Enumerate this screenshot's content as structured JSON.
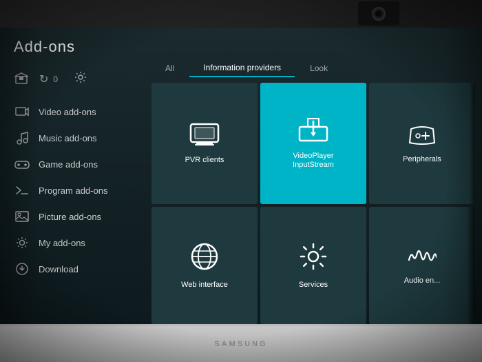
{
  "page": {
    "title": "Add-ons",
    "brand": "SAMSUNG"
  },
  "sidebar": {
    "icons": {
      "addon_icon": "🎓",
      "refresh_icon": "↻",
      "badge_count": "0",
      "settings_icon": "⚙"
    },
    "items": [
      {
        "id": "video",
        "label": "Video add-ons",
        "icon": "video"
      },
      {
        "id": "music",
        "label": "Music add-ons",
        "icon": "music"
      },
      {
        "id": "game",
        "label": "Game add-ons",
        "icon": "game"
      },
      {
        "id": "program",
        "label": "Program add-ons",
        "icon": "program"
      },
      {
        "id": "picture",
        "label": "Picture add-ons",
        "icon": "picture"
      },
      {
        "id": "my",
        "label": "My add-ons",
        "icon": "my"
      },
      {
        "id": "download",
        "label": "Download",
        "icon": "download"
      }
    ]
  },
  "tabs": [
    {
      "id": "all",
      "label": "All",
      "active": false
    },
    {
      "id": "info",
      "label": "Information providers",
      "active": true
    },
    {
      "id": "look",
      "label": "Look",
      "active": false
    }
  ],
  "tiles": [
    {
      "id": "pvr",
      "label": "PVR clients",
      "icon": "tv",
      "active": false
    },
    {
      "id": "videoplayer",
      "label": "VideoPlayer\nInputStream",
      "icon": "download_tile",
      "active": true
    },
    {
      "id": "peripherals",
      "label": "Peripherals",
      "icon": "peripherals",
      "active": false,
      "partial": true
    },
    {
      "id": "web",
      "label": "Web interface",
      "icon": "globe",
      "active": false
    },
    {
      "id": "services",
      "label": "Services",
      "icon": "gear_tile",
      "active": false
    },
    {
      "id": "audio_enc",
      "label": "Audio en...",
      "icon": "audio",
      "active": false,
      "partial": true
    }
  ]
}
